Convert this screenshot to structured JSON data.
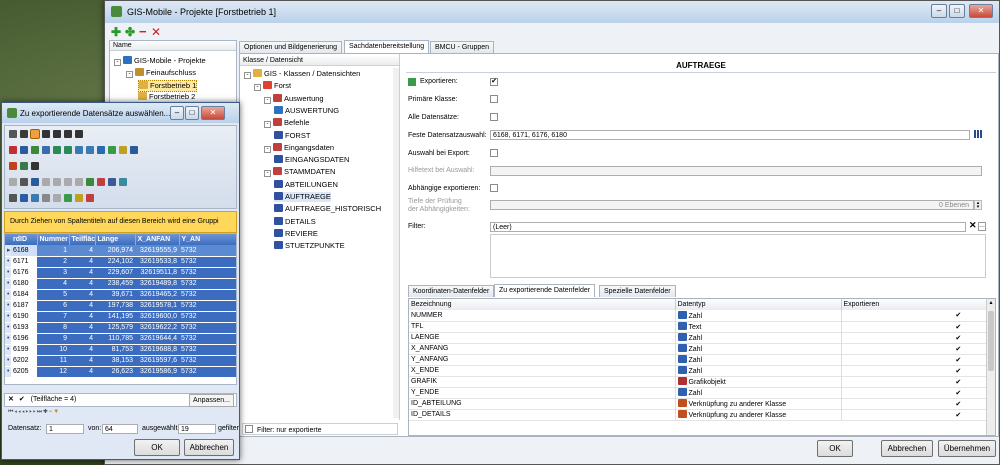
{
  "main_window": {
    "title": "GIS-Mobile - Projekte [Forstbetrieb 1]",
    "name_col": "Name",
    "tree": [
      {
        "label": "GIS-Mobile - Projekte",
        "level": 0,
        "y": 54,
        "color": "#2f6fc0",
        "pm": "-"
      },
      {
        "label": "Feinaufschluss",
        "level": 1,
        "y": 66,
        "color": "#c09030",
        "pm": "-"
      },
      {
        "label": "Forstbetrieb 1",
        "level": 2,
        "y": 78,
        "color": "#e0b040",
        "pm": ""
      },
      {
        "label": "Forstbetrieb 2",
        "level": 2,
        "y": 90,
        "color": "#e0b040",
        "pm": ""
      }
    ],
    "tabs": [
      "Optionen und Bildgenerierung",
      "Sachdatenbereitstellung",
      "BMCU - Gruppen"
    ],
    "class_col": "Klasse / Datensicht",
    "class_tree": [
      {
        "label": "GIS - Klassen / Datensichten",
        "level": 0,
        "pm": "-",
        "c": "#e0b040"
      },
      {
        "label": "Forst",
        "level": 1,
        "pm": "-",
        "c": "#e04030"
      },
      {
        "label": "Auswertung",
        "level": 2,
        "pm": "-",
        "c": "#c04040"
      },
      {
        "label": "AUSWERTUNG",
        "level": 3,
        "pm": "",
        "c": "#3070c0"
      },
      {
        "label": "Befehle",
        "level": 2,
        "pm": "-",
        "c": "#c04040"
      },
      {
        "label": "FORST",
        "level": 3,
        "pm": "",
        "c": "#3050a0"
      },
      {
        "label": "Eingangsdaten",
        "level": 2,
        "pm": "-",
        "c": "#c04040"
      },
      {
        "label": "EINGANGSDATEN",
        "level": 3,
        "pm": "",
        "c": "#3050a0"
      },
      {
        "label": "STAMMDATEN",
        "level": 2,
        "pm": "-",
        "c": "#c04040"
      },
      {
        "label": "ABTEILUNGEN",
        "level": 3,
        "pm": "",
        "c": "#3050a0"
      },
      {
        "label": "AUFTRAEGE",
        "level": 3,
        "pm": "",
        "c": "#3050a0",
        "sel": true
      },
      {
        "label": "AUFTRAEGE_HISTORISCH",
        "level": 3,
        "pm": "",
        "c": "#3050a0"
      },
      {
        "label": "DETAILS",
        "level": 3,
        "pm": "",
        "c": "#3050a0"
      },
      {
        "label": "REVIERE",
        "level": 3,
        "pm": "",
        "c": "#3050a0"
      },
      {
        "label": "STUETZPUNKTE",
        "level": 3,
        "pm": "",
        "c": "#3050a0"
      }
    ],
    "filter_only": "Filter: nur exportierte",
    "section_title": "AUFTRAEGE",
    "exportieren": "Exportieren:",
    "primaere": "Primäre Klasse:",
    "alle": "Alle Datensätze:",
    "feste": "Feste Datensatzauswahl:",
    "feste_val": "6168, 6171, 6176, 6180",
    "auswahl_export": "Auswahl bei Export:",
    "hilfetext": "Hilfetext bei Auswahl:",
    "abh": "Abhängige exportieren:",
    "tiefe": "Tiefe der Prüfung\nder Abhängigkeiten:",
    "tiefe_val": "0 Ebenen",
    "filter": "Filter:",
    "filter_val": "(Leer)",
    "subtabs": [
      "Koordinaten-Datenfelder",
      "Zu exportierende Datenfelder",
      "Spezielle Datenfelder"
    ],
    "cols": [
      "Bezeichnung",
      "Datentyp",
      "Exportieren"
    ],
    "fields": [
      [
        "NUMMER",
        "Zahl",
        "#3060b0"
      ],
      [
        "TFL",
        "Text",
        "#3060b0"
      ],
      [
        "LAENGE",
        "Zahl",
        "#3060b0"
      ],
      [
        "X_ANFANG",
        "Zahl",
        "#3060b0"
      ],
      [
        "Y_ANFANG",
        "Zahl",
        "#3060b0"
      ],
      [
        "X_ENDE",
        "Zahl",
        "#3060b0"
      ],
      [
        "GRAFIK",
        "Grafikobjekt",
        "#b03030"
      ],
      [
        "Y_ENDE",
        "Zahl",
        "#3060b0"
      ],
      [
        "ID_ABTEILUNG",
        "Verknüpfung zu anderer Klasse",
        "#c05020"
      ],
      [
        "ID_DETAILS",
        "Verknüpfung zu anderer Klasse",
        "#c05020"
      ]
    ],
    "ok": "OK",
    "abbrechen": "Abbrechen",
    "uebernehmen": "Übernehmen"
  },
  "dialog": {
    "title": "Zu exportierende Datensätze auswählen...",
    "group_hint": "Durch Ziehen von Spaltentiteln auf diesen Bereich wird eine Gruppi",
    "cols": [
      "rdID",
      "Nummer",
      "Teilfläch",
      "Länge",
      "X_ANFAN",
      "Y_AN"
    ],
    "rows": [
      [
        "6168",
        "1",
        "4",
        "206,974",
        "32619555,9",
        "5732"
      ],
      [
        "6171",
        "2",
        "4",
        "224,102",
        "32619533,8",
        "5732"
      ],
      [
        "6176",
        "3",
        "4",
        "229,607",
        "32619511,8",
        "5732"
      ],
      [
        "6180",
        "4",
        "4",
        "238,459",
        "32619489,8",
        "5732"
      ],
      [
        "6184",
        "5",
        "4",
        "39,671",
        "32619465,2",
        "5732"
      ],
      [
        "6187",
        "6",
        "4",
        "197,738",
        "32619578,1",
        "5732"
      ],
      [
        "6190",
        "7",
        "4",
        "141,195",
        "32619600,0",
        "5732"
      ],
      [
        "6193",
        "8",
        "4",
        "125,579",
        "32619622,2",
        "5732"
      ],
      [
        "6196",
        "9",
        "4",
        "110,785",
        "32619644,4",
        "5732"
      ],
      [
        "6199",
        "10",
        "4",
        "81,753",
        "32619688,8",
        "5732"
      ],
      [
        "6202",
        "11",
        "4",
        "38,153",
        "32619597,6",
        "5732"
      ],
      [
        "6205",
        "12",
        "4",
        "26,623",
        "32619586,9",
        "5732"
      ]
    ],
    "filter_text": "(Teilfläche = 4)",
    "anpassen": "Anpassen...",
    "datensatz": "Datensatz:",
    "ds_val": "1",
    "von": "von:",
    "von_val": "64",
    "ausgewaehlt": "ausgewählt:",
    "aus_val": "19",
    "gefilter": "gefilter",
    "ok": "OK",
    "abbrechen": "Abbrechen"
  }
}
